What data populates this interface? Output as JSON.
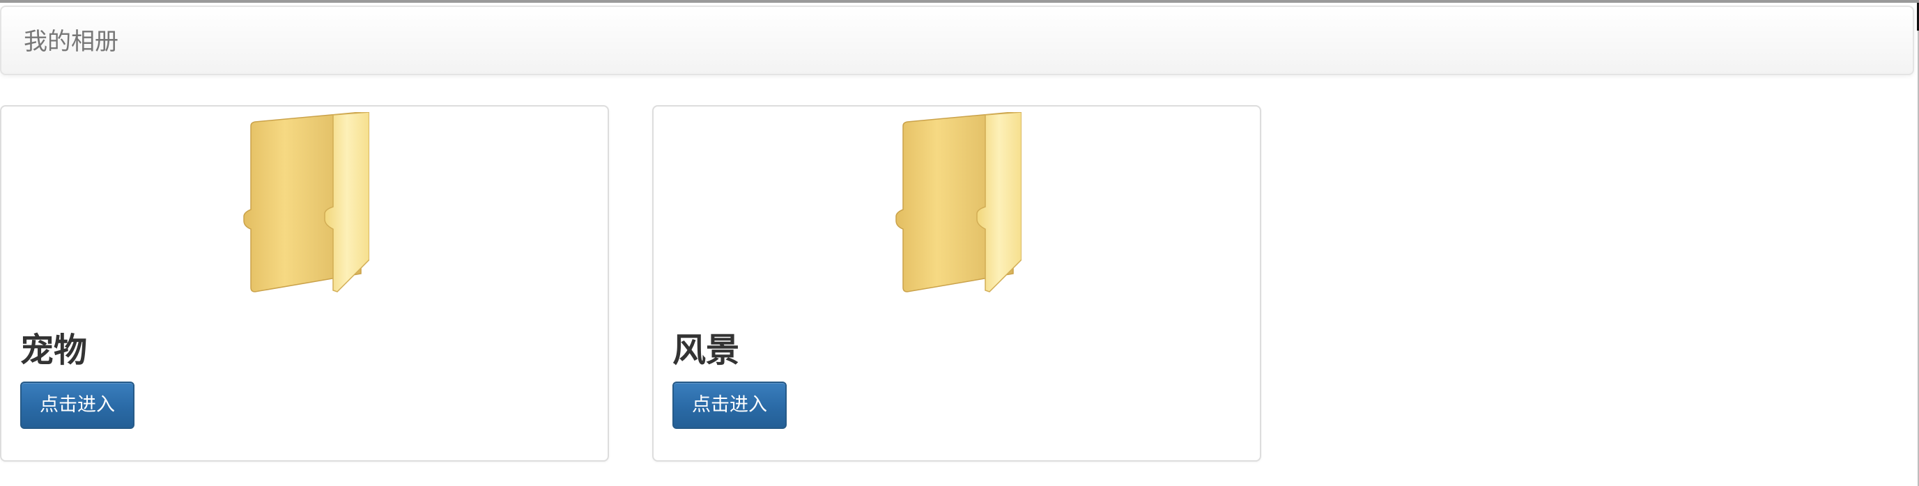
{
  "navbar": {
    "brand": "我的相册"
  },
  "albums": [
    {
      "title": "宠物",
      "button_label": "点击进入",
      "icon": "folder-icon"
    },
    {
      "title": "风景",
      "button_label": "点击进入",
      "icon": "folder-icon"
    }
  ],
  "colors": {
    "button_primary": "#2a6aa6",
    "folder_yellow": "#f5d776",
    "title_text": "#333333",
    "brand_text": "#777777"
  }
}
